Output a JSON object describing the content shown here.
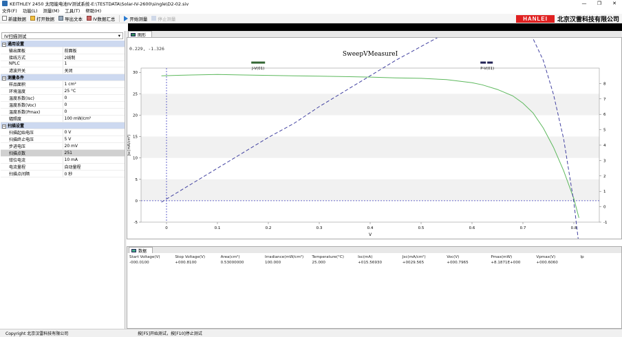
{
  "window": {
    "title": "KEITHLEY 2450 太阳能电池IV测试系统-E:\\TESTDATA\\Solar-IV-2600\\single\\D2-02.siv",
    "buttons": [
      "—",
      "❐",
      "✕"
    ]
  },
  "menu": [
    "文件(F)",
    "功能(L)",
    "测量(M)",
    "工具(T)",
    "帮助(H)"
  ],
  "toolbar": {
    "new": "新建数据",
    "open": "打开数据",
    "export": "导出文本",
    "summary": "IV数据汇总",
    "start": "开始测量",
    "stop": "停止测量"
  },
  "brand": {
    "logo": "HANLEI",
    "company": "北京汉雷科技有限公司"
  },
  "left_panel": {
    "combo_value": "IV扫描测试",
    "sections": [
      {
        "title": "通用设置",
        "rows": [
          {
            "k": "输出面板",
            "v": "前面板"
          },
          {
            "k": "接线方式",
            "v": "2线制"
          },
          {
            "k": "NPLC",
            "v": "1"
          },
          {
            "k": "滤波开关",
            "v": "关闭"
          }
        ]
      },
      {
        "title": "测量条件",
        "rows": [
          {
            "k": "样品面积",
            "v": "1 cm²"
          },
          {
            "k": "环境温度",
            "v": "25 °C"
          },
          {
            "k": "温度系数(Isc)",
            "v": "0"
          },
          {
            "k": "温度系数(Voc)",
            "v": "0"
          },
          {
            "k": "温度系数(Pmax)",
            "v": "0"
          },
          {
            "k": "辐照度",
            "v": "100 mW/cm²"
          }
        ]
      },
      {
        "title": "扫描设置",
        "rows": [
          {
            "k": "扫描起始电压",
            "v": "0  V"
          },
          {
            "k": "扫描终止电压",
            "v": "5  V"
          },
          {
            "k": "步进电压",
            "v": "20 mV"
          },
          {
            "k": "扫描点数",
            "v": "251"
          },
          {
            "k": "钳位电流",
            "v": "10 mA"
          },
          {
            "k": "电流量程",
            "v": "自动量程"
          },
          {
            "k": "扫描点间隔",
            "v": "0 秒"
          }
        ]
      }
    ]
  },
  "chart_tab": "图形",
  "coords_readout": "0.229, -1.326",
  "data_tab": "数据",
  "data_table": {
    "headers": [
      "Start Voltage(V)",
      "Stop Voltage(V)",
      "Area(cm²)",
      "Irradiance(mW/cm²)",
      "Temperature(°C)",
      "Isc(mA)",
      "Jsc(mA/cm²)",
      "Voc(V)",
      "Pmax(mW)",
      "Vpmax(V)",
      "Ip"
    ],
    "row": [
      "-000.0100",
      "+000.8100",
      "0.53000000",
      "100.000",
      "25.000",
      "+015.56930",
      "+0029.565",
      "+000.7965",
      "+8.1871E+000",
      "+000.6060",
      ""
    ]
  },
  "status": {
    "copyright": "Copyright 北京汉雷科技有限公司",
    "hint": "按[F5]开始测试，按[F10]停止测试"
  },
  "chart_data": {
    "type": "line",
    "title": "SweepVMeasureI",
    "xlabel": "V",
    "ylabel": "Jsc(mA/cm²)",
    "xlim": [
      -0.05,
      0.85
    ],
    "ylim_left": [
      -5,
      31
    ],
    "ylim_right": [
      -1,
      9
    ],
    "x_ticks": [
      0.0,
      0.1,
      0.2,
      0.3,
      0.4,
      0.5,
      0.6,
      0.7,
      0.8
    ],
    "y_ticks_left": [
      -5,
      0,
      5,
      10,
      15,
      20,
      25,
      30
    ],
    "y_ticks_right": [
      -1,
      0,
      1,
      2,
      3,
      4,
      5,
      6,
      7,
      8
    ],
    "legend_placement": "top",
    "colors": {
      "jv": "#5cb85c",
      "pv": "#4040a0",
      "zero_line": "#4040c0"
    },
    "series": [
      {
        "name": "J-V(01)",
        "axis": "left",
        "style": "solid",
        "x": [
          -0.01,
          0.05,
          0.1,
          0.15,
          0.2,
          0.25,
          0.3,
          0.35,
          0.4,
          0.45,
          0.5,
          0.55,
          0.6,
          0.62,
          0.65,
          0.68,
          0.7,
          0.72,
          0.74,
          0.76,
          0.78,
          0.8,
          0.81
        ],
        "values": [
          29.2,
          29.4,
          29.5,
          29.4,
          29.3,
          29.2,
          29.1,
          29.0,
          28.9,
          28.7,
          28.6,
          28.3,
          27.6,
          27.1,
          26.0,
          24.5,
          22.8,
          20.5,
          17.0,
          12.5,
          7.0,
          0.5,
          -4.0
        ]
      },
      {
        "name": "P-V(01)",
        "axis": "right",
        "style": "dashed",
        "x": [
          -0.01,
          0.05,
          0.1,
          0.15,
          0.2,
          0.25,
          0.3,
          0.35,
          0.4,
          0.45,
          0.5,
          0.55,
          0.6,
          0.62,
          0.65,
          0.68,
          0.7,
          0.72,
          0.74,
          0.76,
          0.78,
          0.8,
          0.81
        ],
        "values": [
          0.3,
          1.5,
          2.5,
          3.5,
          4.5,
          5.4,
          6.5,
          7.5,
          8.5,
          9.5,
          10.4,
          11.3,
          12.0,
          12.2,
          12.3,
          12.1,
          11.6,
          10.9,
          9.5,
          7.3,
          4.4,
          0.3,
          -2.5
        ]
      }
    ]
  }
}
